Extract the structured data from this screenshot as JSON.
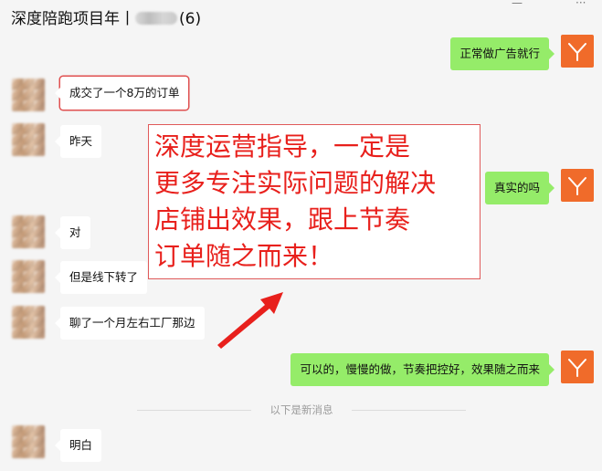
{
  "header": {
    "title_prefix": "深度陪跑项目年丨",
    "title_suffix": "(6)"
  },
  "messages": [
    {
      "side": "right",
      "text": "正常做广告就行"
    },
    {
      "side": "left",
      "text": "成交了一个8万的订单",
      "highlighted": true
    },
    {
      "side": "left",
      "text": "昨天"
    },
    {
      "side": "right",
      "text": "真实的吗"
    },
    {
      "side": "left",
      "text": "对"
    },
    {
      "side": "left",
      "text": "但是线下转了"
    },
    {
      "side": "left",
      "text": "聊了一个月左右工厂那边"
    },
    {
      "side": "right",
      "text": "可以的，慢慢的做，节奏把控好，效果随之而来"
    },
    {
      "side": "left",
      "text": "明白"
    }
  ],
  "divider_label": "以下是新消息",
  "annotation": {
    "lines": [
      "深度运营指导，一定是",
      "更多专注实际问题的解决",
      "店铺出效果，跟上节奏",
      "订单随之而来！"
    ],
    "color": "#e8201c"
  },
  "colors": {
    "background": "#f5f5f5",
    "bubble_self": "#95ec69",
    "bubble_other": "#ffffff",
    "avatar_self": "#f06b2a"
  }
}
